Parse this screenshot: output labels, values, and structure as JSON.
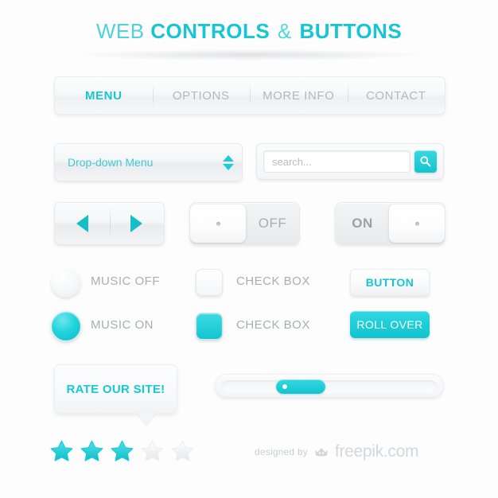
{
  "header": {
    "title_parts": [
      {
        "text": "WEB",
        "weight": "light"
      },
      {
        "text": "CONTROLS",
        "weight": "bold"
      },
      {
        "text": "&",
        "weight": "amp"
      },
      {
        "text": "BUTTONS",
        "weight": "bold"
      }
    ],
    "title_full": "WEB CONTROLS & BUTTONS"
  },
  "menubar": {
    "items": [
      {
        "label": "MENU",
        "active": true
      },
      {
        "label": "OPTIONS",
        "active": false
      },
      {
        "label": "MORE INFO",
        "active": false
      },
      {
        "label": "CONTACT",
        "active": false
      }
    ]
  },
  "dropdown": {
    "label": "Drop-down Menu",
    "up_icon": "chevron-up-icon",
    "down_icon": "chevron-down-icon"
  },
  "search": {
    "placeholder": "search...",
    "value": "",
    "button_icon": "magnifier-icon"
  },
  "arrow_nav": {
    "prev_icon": "triangle-left-icon",
    "next_icon": "triangle-right-icon"
  },
  "toggles": [
    {
      "name": "toggle-off",
      "label": "OFF",
      "state": "off",
      "knob_side": "left"
    },
    {
      "name": "toggle-on",
      "label": "ON",
      "state": "on",
      "knob_side": "right"
    }
  ],
  "radios": [
    {
      "label": "MUSIC OFF",
      "checked": false
    },
    {
      "label": "MUSIC ON",
      "checked": true
    }
  ],
  "checkboxes": [
    {
      "label": "CHECK BOX",
      "checked": false
    },
    {
      "label": "CHECK BOX",
      "checked": true
    }
  ],
  "buttons": [
    {
      "label": "BUTTON",
      "style": "plain"
    },
    {
      "label": "ROLL OVER",
      "style": "rollover"
    }
  ],
  "tooltip": {
    "label": "RATE OUR SITE!"
  },
  "rating": {
    "filled": 3,
    "total": 5,
    "star_icon": "star-icon"
  },
  "slider": {
    "handle_position_percent": 25,
    "handle_width_percent": 22,
    "dot_icon": "handle-dot-icon"
  },
  "footer": {
    "prefix": "designed by",
    "brand": "freepik.com",
    "logo_icon": "freepik-crown-icon"
  },
  "colors": {
    "accent_teal": "#16c6d2",
    "accent_teal_light": "#3ddbe3",
    "gray_text": "#a9aeb3",
    "panel_bg": "#f5f6f8",
    "page_bg": "#fdfdfd"
  }
}
